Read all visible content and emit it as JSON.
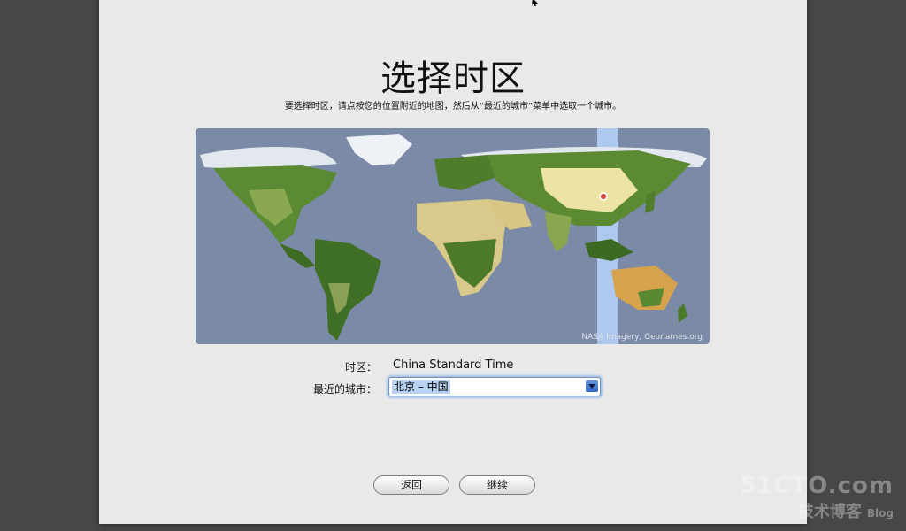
{
  "page": {
    "title": "选择时区",
    "subtitle": "要选择时区，请点按您的位置附近的地图，然后从“最近的城市”菜单中选取一个城市。"
  },
  "map": {
    "credit": "NASA Imagery, Geonames.org",
    "timezone_band_color": "#bcd8ff",
    "ocean_color": "#7b8aa6",
    "land_color": "#4e7a2c",
    "desert_color": "#d8c98a",
    "ice_color": "#eef2f6",
    "selected_pin_color": "#e0504a"
  },
  "form": {
    "timezone_label": "时区：",
    "timezone_value": "China Standard Time",
    "city_label": "最近的城市：",
    "city_value": "北京 – 中国"
  },
  "buttons": {
    "back": "返回",
    "continue": "继续"
  },
  "watermark": {
    "line1": "51CTO.com",
    "line2": "技术博客",
    "blog": "Blog"
  }
}
